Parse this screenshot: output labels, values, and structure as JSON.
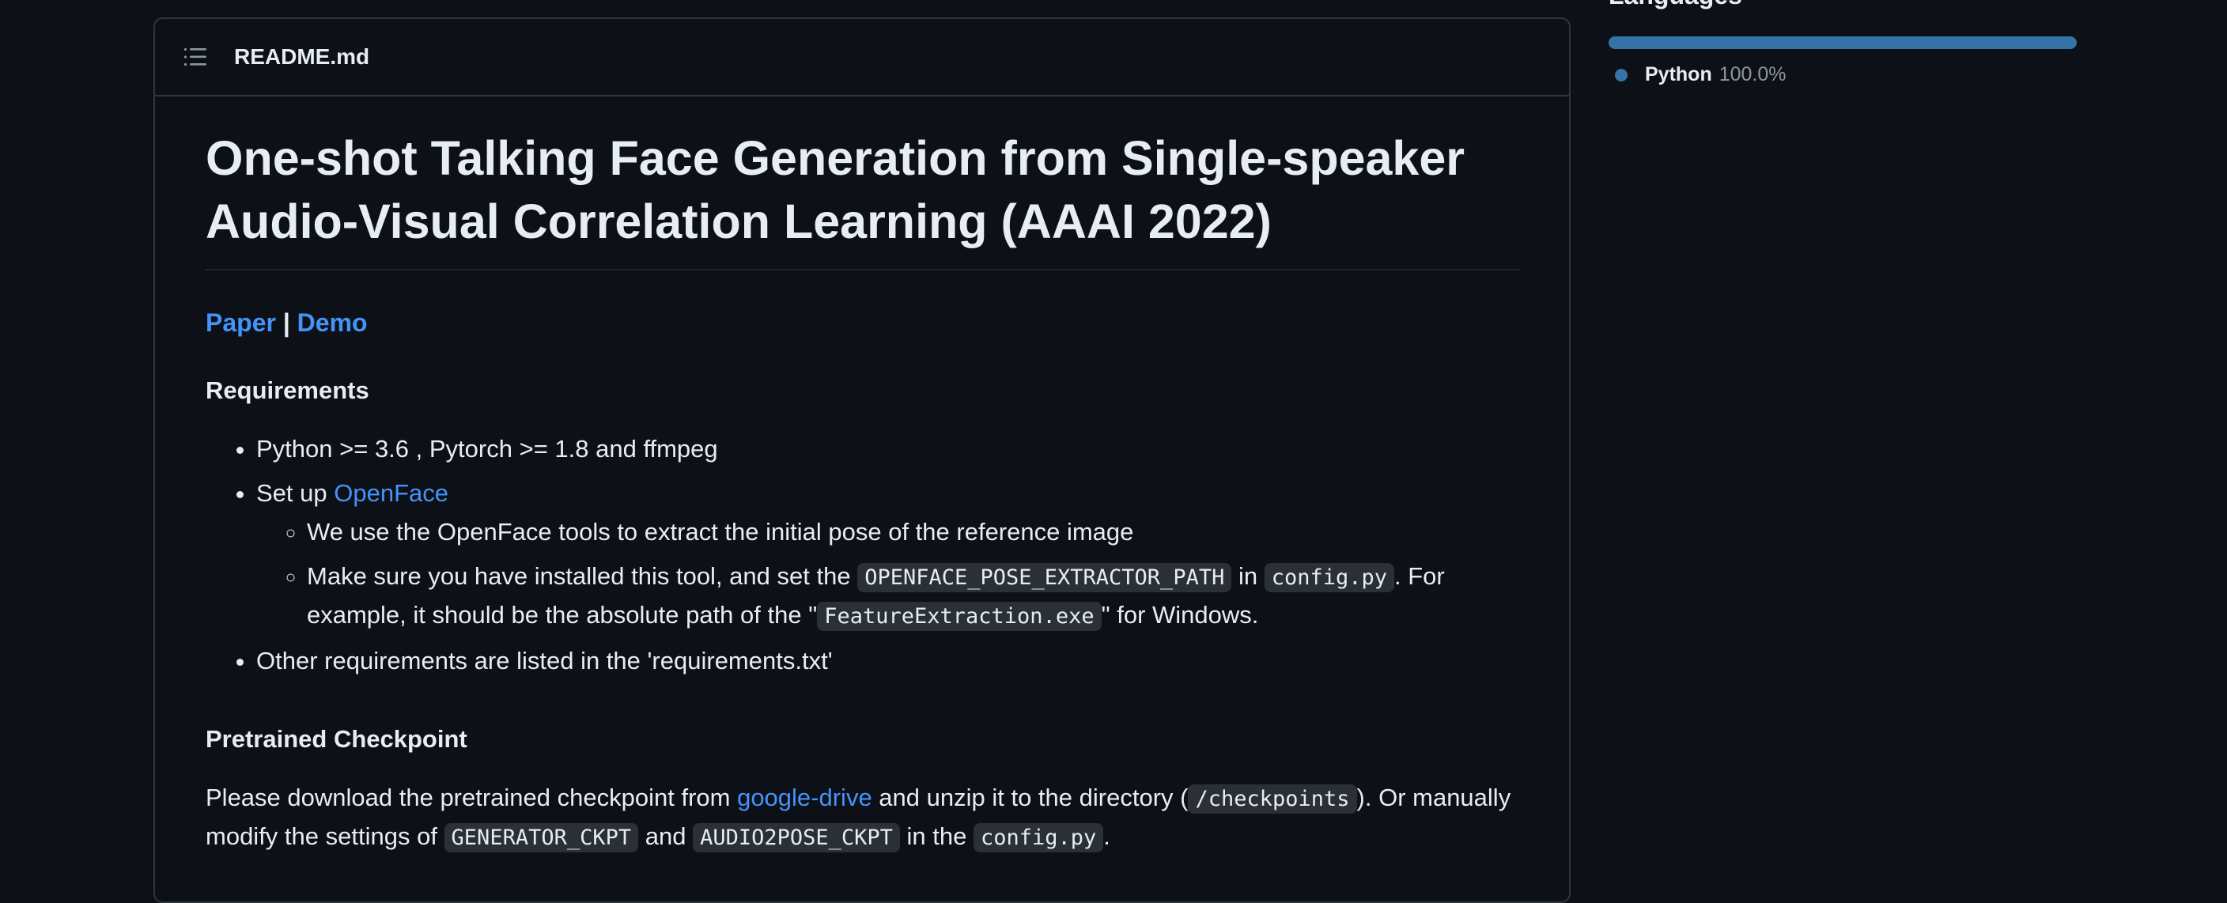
{
  "readme": {
    "filename": "README.md",
    "title": "One-shot Talking Face Generation from Single-speaker Audio-Visual Correlation Learning (AAAI 2022)",
    "links": {
      "paper": "Paper",
      "separator": "|",
      "demo": "Demo"
    },
    "requirements": {
      "heading": "Requirements",
      "item1": "Python >= 3.6 , Pytorch >= 1.8 and ffmpeg",
      "item2_prefix": "Set up ",
      "item2_link": "OpenFace",
      "sub1": "We use the OpenFace tools to extract the initial pose of the reference image",
      "sub2_a": "Make sure you have installed this tool, and set the ",
      "sub2_code1": "OPENFACE_POSE_EXTRACTOR_PATH",
      "sub2_b": " in ",
      "sub2_code2": "config.py",
      "sub2_c": ". For example, it should be the absolute path of the \"",
      "sub2_code3": "FeatureExtraction.exe",
      "sub2_d": "\" for Windows.",
      "item3": "Other requirements are listed in the 'requirements.txt'"
    },
    "checkpoint": {
      "heading": "Pretrained Checkpoint",
      "p_a": "Please download the pretrained checkpoint from ",
      "p_link": "google-drive",
      "p_b": " and unzip it to the directory (",
      "p_code1": "/checkpoints",
      "p_c": "). Or manually modify the settings of ",
      "p_code2": "GENERATOR_CKPT",
      "p_d": " and ",
      "p_code3": "AUDIO2POSE_CKPT",
      "p_e": " in the ",
      "p_code4": "config.py",
      "p_f": "."
    }
  },
  "sidebar": {
    "languages_heading": "Languages",
    "languages": [
      {
        "name": "Python",
        "percent": "100.0%",
        "fraction": 1.0,
        "color": "#3572a5"
      }
    ]
  },
  "icons": {
    "outline": "list-icon"
  }
}
